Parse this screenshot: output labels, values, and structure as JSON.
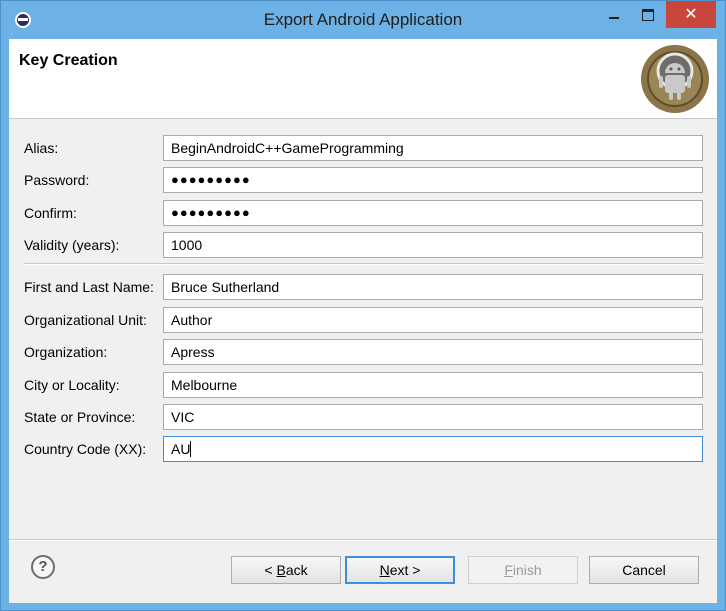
{
  "window": {
    "title": "Export Android Application",
    "close_glyph": "✕"
  },
  "header": {
    "title": "Key Creation"
  },
  "form": {
    "alias": {
      "label": "Alias:",
      "value": "BeginAndroidC++GameProgramming"
    },
    "password": {
      "label": "Password:",
      "value": "●●●●●●●●●"
    },
    "confirm": {
      "label": "Confirm:",
      "value": "●●●●●●●●●"
    },
    "validity": {
      "label": "Validity (years):",
      "value": "1000"
    },
    "name": {
      "label": "First and Last Name:",
      "value": "Bruce Sutherland"
    },
    "org_unit": {
      "label": "Organizational Unit:",
      "value": "Author"
    },
    "organization": {
      "label": "Organization:",
      "value": "Apress"
    },
    "city": {
      "label": "City or Locality:",
      "value": "Melbourne"
    },
    "state": {
      "label": "State or Province:",
      "value": "VIC"
    },
    "country": {
      "label": "Country Code (XX):",
      "value": "AU"
    }
  },
  "buttons": {
    "help_glyph": "?",
    "back_prefix": "< ",
    "back_mnemonic": "B",
    "back_rest": "ack",
    "next_mnemonic": "N",
    "next_rest": "ext >",
    "finish_mnemonic": "F",
    "finish_rest": "inish",
    "cancel": "Cancel"
  },
  "icons": {
    "app": "eclipse-icon",
    "logo": "android-adt-logo"
  }
}
